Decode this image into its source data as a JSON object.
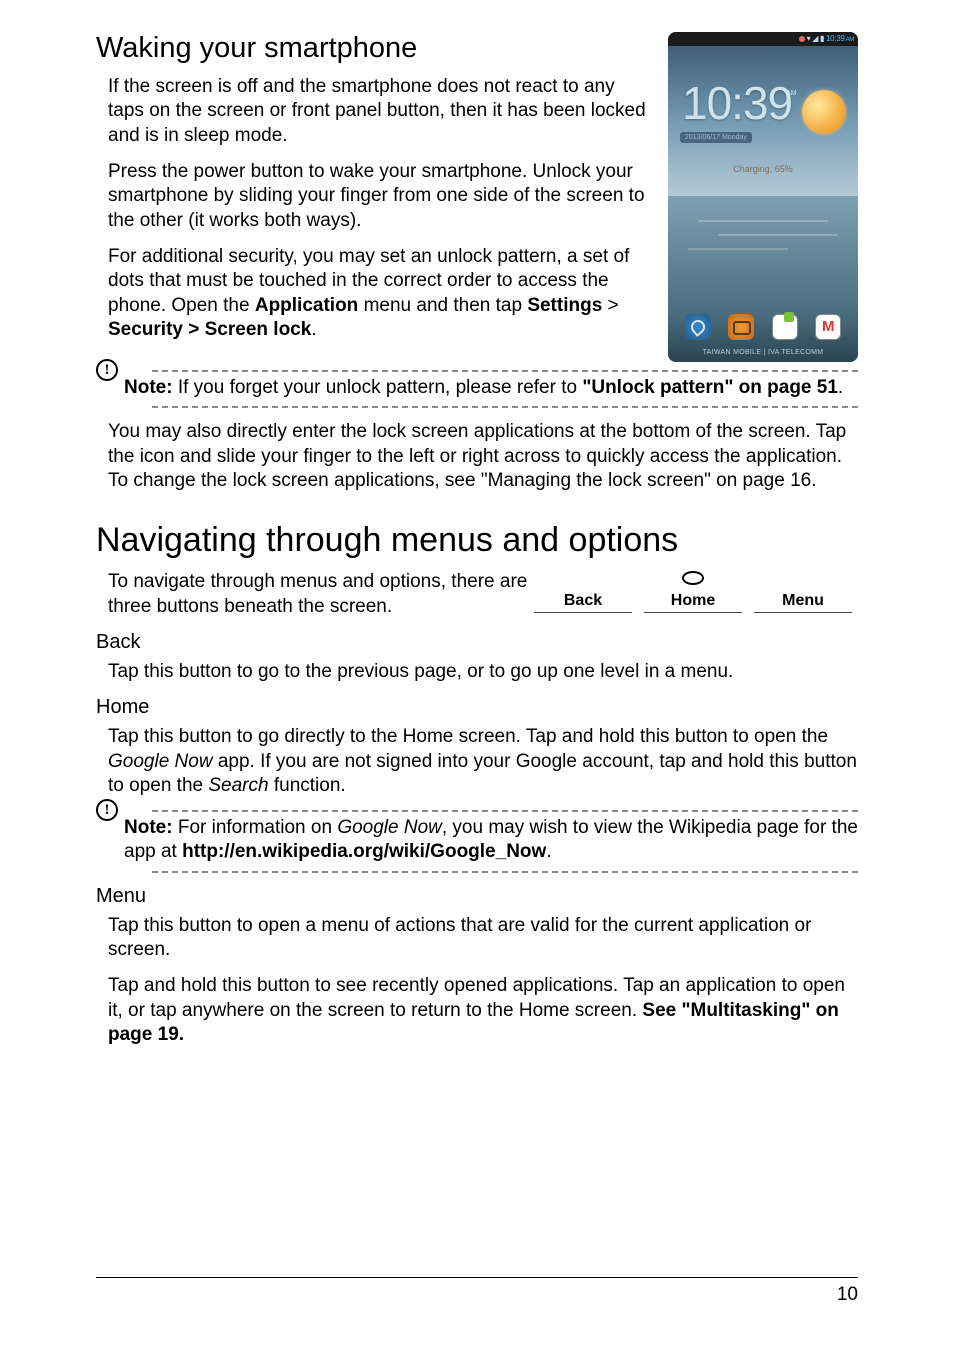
{
  "h2_waking": "Waking your smartphone",
  "waking_p1": "If the screen is off and the smartphone does not react to any taps on the screen or front panel button, then it has been locked and is in sleep mode.",
  "waking_p2": "Press the power button to wake your smartphone. Unlock your smartphone by sliding your finger from one side of the screen to the other (it works both ways).",
  "waking_p3_a": "For additional security, you may set an unlock pattern, a set of dots that must be touched in the correct order to access the phone. Open the ",
  "waking_p3_b": "Application",
  "waking_p3_c": " menu and then tap ",
  "waking_p3_d": "Settings",
  "waking_p3_e": " > ",
  "waking_p3_f": "Security > Screen lock",
  "waking_p3_g": ".",
  "note1_label": "Note:",
  "note1_body_a": " If you forget your unlock pattern, please refer to ",
  "note1_body_b": "\"Unlock pattern\" on page 51",
  "note1_body_c": ".",
  "waking_p4": "You may also directly enter the lock screen applications at the bottom of the screen. Tap the icon and slide your finger to the left or right across to quickly access the application. To change the lock screen applications, see \"Managing the lock screen\" on page 16.",
  "h1_nav": "Navigating through menus and options",
  "nav_intro": "To navigate through menus and options, there are three buttons beneath the screen.",
  "nav_labels": {
    "back": "Back",
    "home": "Home",
    "menu": "Menu"
  },
  "h3_back": "Back",
  "back_p": "Tap this button to go to the previous page, or to go up one level in a menu.",
  "h3_home": "Home",
  "home_p_a": "Tap this button to go directly to the Home screen. Tap and hold this button to open the ",
  "home_p_b": "Google Now",
  "home_p_c": " app. If you are not signed into your Google account, tap and hold this button to open the ",
  "home_p_d": "Search",
  "home_p_e": " function.",
  "note2_label": "Note:",
  "note2_a": " For information on ",
  "note2_b": "Google Now",
  "note2_c": ", you may wish to view the Wikipedia page for the app at ",
  "note2_d": "http://en.wikipedia.org/wiki/Google_Now",
  "note2_e": ".",
  "h3_menu": "Menu",
  "menu_p1": "Tap this button to open a menu of actions that are valid for the current application or screen.",
  "menu_p2_a": "Tap and hold this button to see recently opened applications. Tap an application to open it, or tap anywhere on the screen to return to the Home screen. ",
  "menu_p2_b": "See \"Multitasking\" on page 19.",
  "page_num": "10",
  "phone": {
    "status_time": "10:39",
    "clock": "10:39",
    "ampm": "AM",
    "date": "2013/06/17 Monday",
    "charging": "Charging, 65%",
    "carrier": "TAIWAN MOBILE   |   IVA TELECOMM"
  }
}
